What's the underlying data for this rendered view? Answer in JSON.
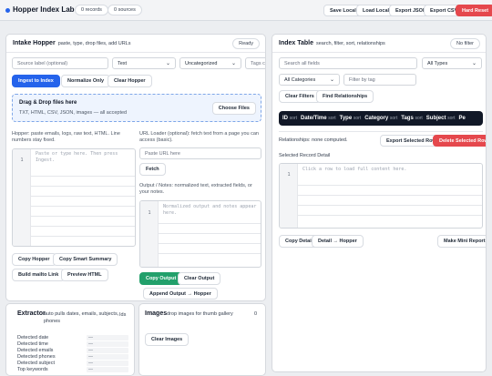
{
  "app": {
    "title": "Hopper Index Lab",
    "records": "0 records",
    "sources": "0 sources"
  },
  "topbar": {
    "save_local": "Save Local",
    "load_local": "Load Local",
    "export_json": "Export JSON",
    "export_csv": "Export CSV",
    "hard_reset": "Hard Reset"
  },
  "intake": {
    "title": "Intake Hopper",
    "subtitle": "paste, type, drop files, add URLs",
    "status": "Ready",
    "source_label_placeholder": "Source label (optional)",
    "type_select": "Text",
    "category_select": "Uncategorized",
    "tags_placeholder": "Tags comma",
    "ingest": "Ingest to Index",
    "normalize": "Normalize Only",
    "clear": "Clear Hopper",
    "drop_title": "Drag & Drop files here",
    "drop_sub": "TXT, HTML, CSV, JSON, images — all accepted",
    "choose_files": "Choose Files",
    "hopper_help": "Hopper: paste emails, logs, raw text, HTML. Line numbers stay fixed.",
    "hopper_placeholder": "Paste or type here. Then press Ingest.",
    "copy_hopper": "Copy Hopper",
    "copy_smart": "Copy Smart Summary",
    "build_mailto": "Build mailto Link",
    "preview_html": "Preview HTML",
    "url_help": "URL Loader (optional): fetch text from a page you can access (basic).",
    "url_placeholder": "Paste URL here",
    "fetch": "Fetch",
    "output_help": "Output / Notes: normalized text, extracted fields, or your notes.",
    "output_placeholder": "Normalized output and notes appear here.",
    "copy_output": "Copy Output",
    "clear_output": "Clear Output",
    "append_output": "Append Output → Hopper"
  },
  "extractor": {
    "title": "Extractor",
    "subtitle": "auto pulls dates, emails, subjects, phones",
    "ids": "Ids",
    "fields": [
      {
        "label": "Detected date",
        "value": "—"
      },
      {
        "label": "Detected time",
        "value": "—"
      },
      {
        "label": "Detected emails",
        "value": "—"
      },
      {
        "label": "Detected phones",
        "value": "—"
      },
      {
        "label": "Detected subject",
        "value": "—"
      },
      {
        "label": "Top keywords",
        "value": "—"
      }
    ]
  },
  "images": {
    "title": "Images",
    "subtitle": "drop images for thumb gallery",
    "count": "0",
    "clear": "Clear Images"
  },
  "index": {
    "title": "Index Table",
    "subtitle": "search, filter, sort, relationships",
    "filter_status": "No filter",
    "search_placeholder": "Search all fields",
    "types_select": "All Types",
    "categories_select": "All Categories",
    "tag_placeholder": "Filter by tag",
    "clear_filters": "Clear Filters",
    "find_relationships": "Find Relationships",
    "columns": [
      {
        "label": "ID",
        "sort": "sort"
      },
      {
        "label": "Date/Time",
        "sort": "sort"
      },
      {
        "label": "Type",
        "sort": "sort"
      },
      {
        "label": "Category",
        "sort": "sort"
      },
      {
        "label": "Tags",
        "sort": "sort"
      },
      {
        "label": "Subject",
        "sort": "sort"
      },
      {
        "label": "Pe",
        "sort": ""
      }
    ],
    "relationships": "Relationships: none computed.",
    "export_row": "Export Selected Row",
    "delete_row": "Delete Selected Row",
    "detail_label": "Selected Record Detail",
    "detail_placeholder": "Click a row to load full content here.",
    "copy_detail": "Copy Detail",
    "detail_hopper": "Detail → Hopper",
    "mini_report": "Make Mini Report"
  },
  "colors": {
    "accent": "#2563eb",
    "danger": "#e5484d",
    "success": "#22a06b",
    "table_header": "#111827"
  }
}
